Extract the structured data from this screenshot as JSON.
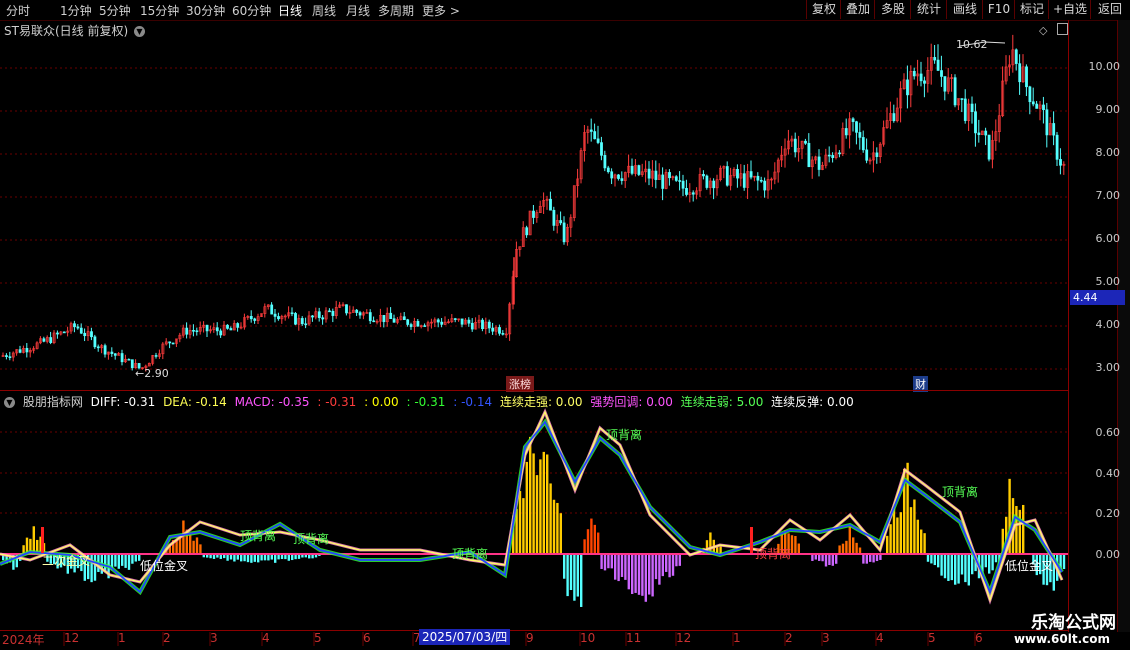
{
  "toolbar": {
    "periods": [
      "分时",
      "1分钟",
      "5分钟",
      "15分钟",
      "30分钟",
      "60分钟",
      "日线",
      "周线",
      "月线",
      "多周期",
      "更多 >"
    ],
    "active_period": "日线",
    "right_buttons": [
      "复权",
      "叠加",
      "多股",
      "统计",
      "画线",
      "F10",
      "标记",
      "+自选",
      "返回"
    ]
  },
  "main_chart": {
    "title": "ST易联众(日线 前复权)",
    "y_labels": [
      "10.00",
      "9.00",
      "8.00",
      "7.00",
      "6.00",
      "5.00",
      "4.00",
      "3.00"
    ],
    "current_price": "4.44",
    "high_label": "10.62",
    "low_label": "2.90",
    "tag_zhangbang": "涨榜",
    "tag_cai": "财"
  },
  "indicator": {
    "name": "股朋指标网",
    "diff": "DIFF: -0.31",
    "dea": "DEA: -0.14",
    "macd": "MACD: -0.35",
    "v1": ": -0.31",
    "v2": ": 0.00",
    "v3": ": -0.31",
    "v4": ": -0.14",
    "lianxu_zouqiang": "连续走强: 0.00",
    "qiangshi_huitiao": "强势回调: 0.00",
    "lianxu_zouruo": "连续走弱: 5.00",
    "lianxu_fantan": "连续反弹: 0.00",
    "y_labels": [
      "0.60",
      "0.40",
      "0.20",
      "0.00"
    ],
    "annotations": [
      "顶背离",
      "顶背离",
      "顶背离",
      "顶背离",
      "顶背离",
      "顶背离",
      "低位金叉",
      "二次金叉",
      "低位金叉",
      "顶背离"
    ]
  },
  "x_axis": {
    "labels": [
      "2024年",
      "12",
      "1",
      "2",
      "3",
      "4",
      "5",
      "6",
      "7",
      "9",
      "10",
      "11",
      "12",
      "1",
      "2",
      "3",
      "4",
      "5",
      "6"
    ],
    "cursor_date": "2025/07/03/四"
  },
  "watermark": {
    "line1": "乐淘公式网",
    "line2": "www.60lt.com"
  },
  "colors": {
    "up": "#ff3c3c",
    "down": "#54ffff",
    "grid": "#7a0000",
    "diff": "#ffffff",
    "dea": "#ffff00",
    "macd": "#ff55ff"
  }
}
